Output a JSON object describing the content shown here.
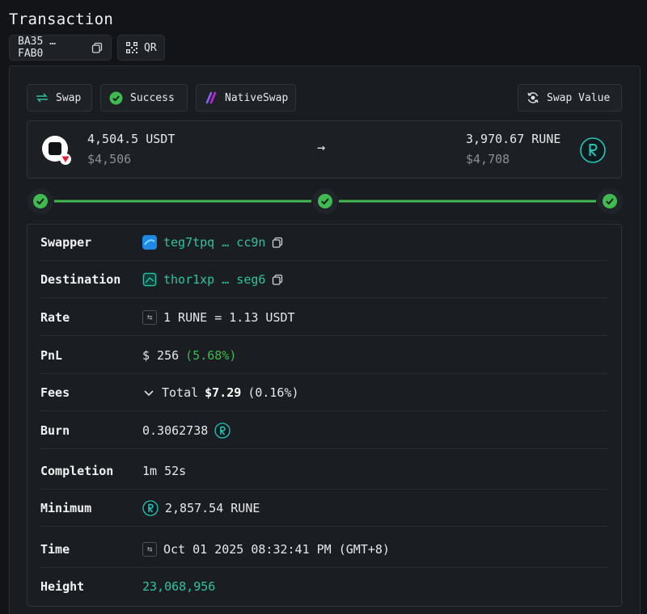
{
  "header": {
    "title": "Transaction",
    "tx_hash": "BA35 … FAB0",
    "qr_label": "QR"
  },
  "tags": {
    "type": "Swap",
    "status": "Success",
    "protocol": "NativeSwap",
    "value_button": "Swap Value"
  },
  "swap": {
    "in_amount": "4,504.5 USDT",
    "in_usd": "$4,506",
    "arrow": "→",
    "out_amount": "3,970.67 RUNE",
    "out_usd": "$4,708"
  },
  "progress": {
    "steps_completed": 3,
    "steps_total": 3
  },
  "details": {
    "swapper": {
      "label": "Swapper",
      "value": "teg7tpq … cc9n"
    },
    "destination": {
      "label": "Destination",
      "value": "thor1xp … seg6"
    },
    "rate": {
      "label": "Rate",
      "value": "1 RUNE = 1.13 USDT"
    },
    "pnl": {
      "label": "PnL",
      "value": "$ 256",
      "percent": "(5.68%)"
    },
    "fees": {
      "label": "Fees",
      "prefix": "Total",
      "amount": "$7.29",
      "percent": "(0.16%)"
    },
    "burn": {
      "label": "Burn",
      "value": "0.3062738"
    },
    "completion": {
      "label": "Completion",
      "value": "1m 52s"
    },
    "minimum": {
      "label": "Minimum",
      "value": "2,857.54 RUNE"
    },
    "time": {
      "label": "Time",
      "value": "Oct 01 2025 08:32:41 PM (GMT+8)"
    },
    "height": {
      "label": "Height",
      "value": "23,068,956"
    }
  },
  "colors": {
    "accent_green": "#3fb950",
    "link_teal": "#2ec4a0",
    "rune_teal": "#23c6b8",
    "background": "#121417"
  },
  "icons": {
    "copy": "copy-icon",
    "qr": "qr-code-icon",
    "swap": "swap-arrows-icon",
    "success": "check-circle-icon",
    "protocol": "native-swap-logo",
    "value": "refresh-dollar-icon",
    "rune": "rune-token-icon"
  }
}
